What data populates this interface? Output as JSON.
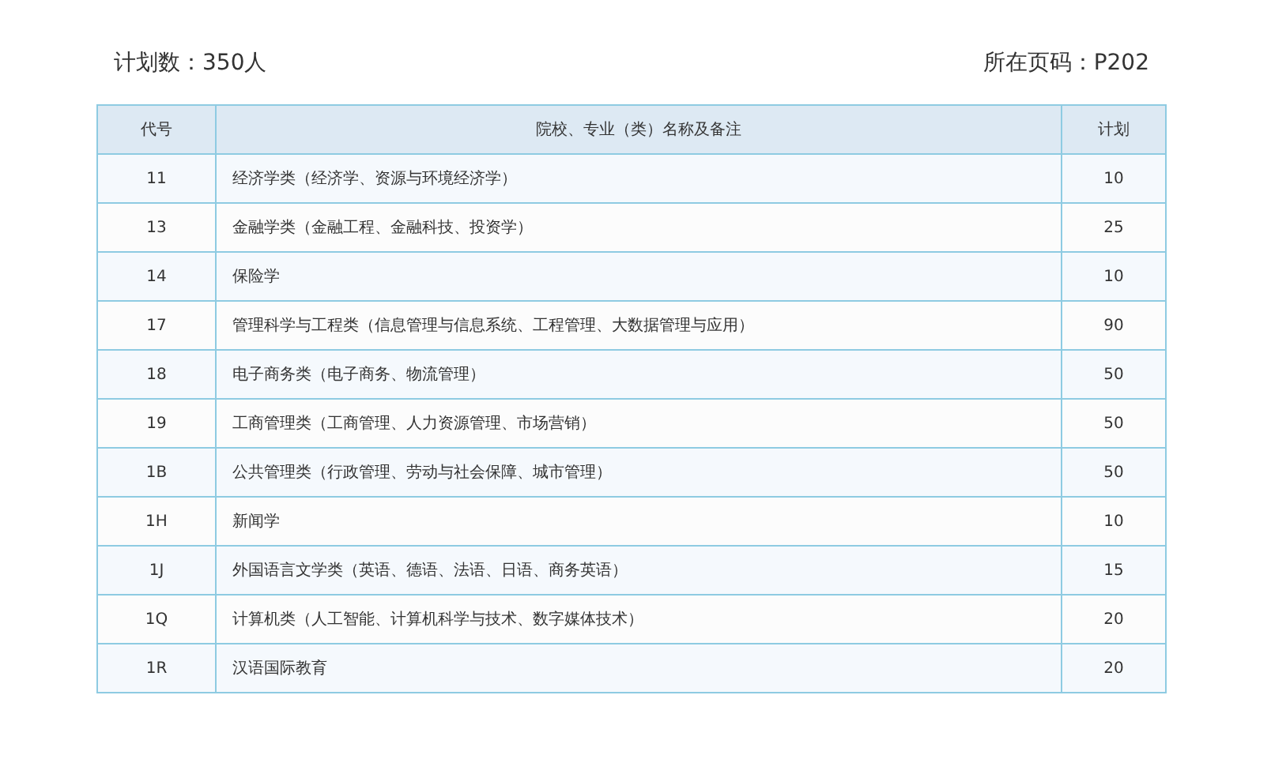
{
  "summary": {
    "plan_count": "计划数：350人",
    "page_code": "所在页码：P202"
  },
  "table": {
    "columns": [
      "代号",
      "院校、专业（类）名称及备注",
      "计划"
    ],
    "rows": [
      [
        "11",
        "经济学类（经济学、资源与环境经济学）",
        "10"
      ],
      [
        "13",
        "金融学类（金融工程、金融科技、投资学）",
        "25"
      ],
      [
        "14",
        "保险学",
        "10"
      ],
      [
        "17",
        "管理科学与工程类（信息管理与信息系统、工程管理、大数据管理与应用）",
        "90"
      ],
      [
        "18",
        "电子商务类（电子商务、物流管理）",
        "50"
      ],
      [
        "19",
        "工商管理类（工商管理、人力资源管理、市场营销）",
        "50"
      ],
      [
        "1B",
        "公共管理类（行政管理、劳动与社会保障、城市管理）",
        "50"
      ],
      [
        "1H",
        "新闻学",
        "10"
      ],
      [
        "1J",
        "外国语言文学类（英语、德语、法语、日语、商务英语）",
        "15"
      ],
      [
        "1Q",
        "计算机类（人工智能、计算机科学与技术、数字媒体技术）",
        "20"
      ],
      [
        "1R",
        "汉语国际教育",
        "20"
      ]
    ]
  }
}
